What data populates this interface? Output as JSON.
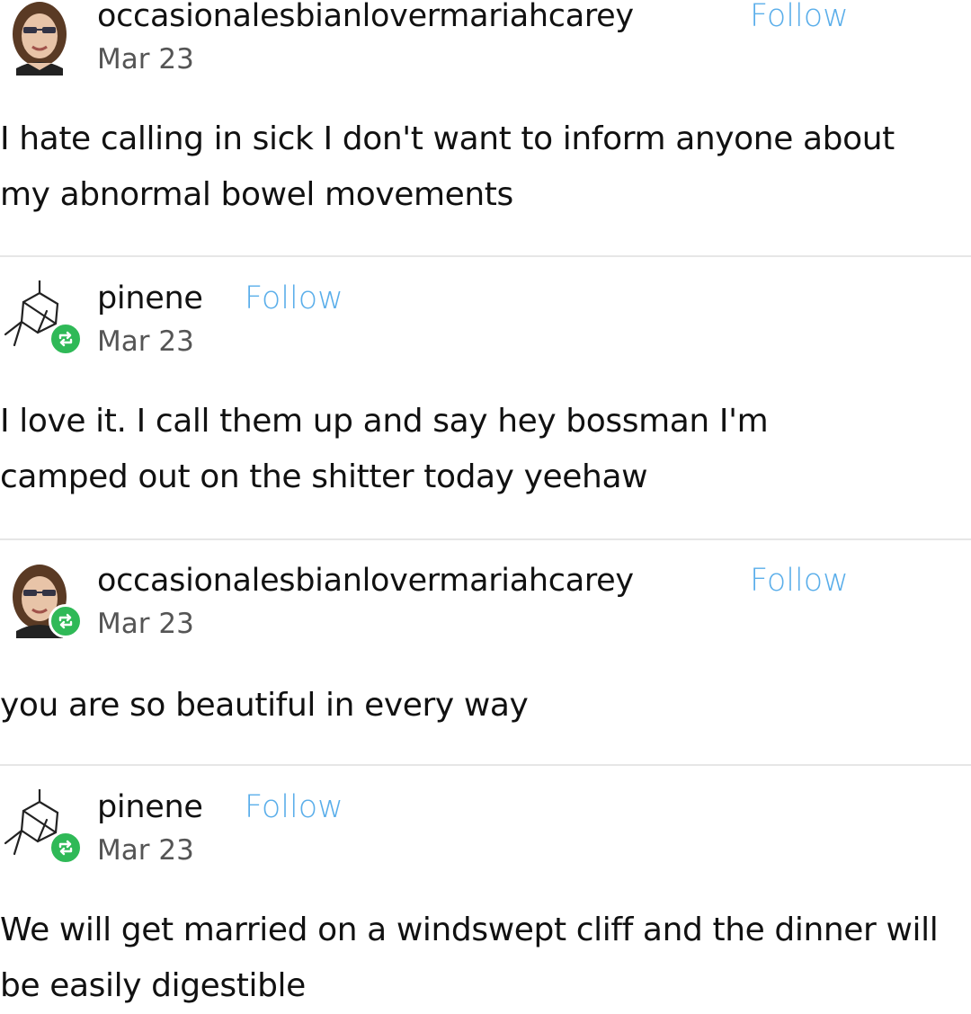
{
  "posts": [
    {
      "username": "occasionalesbianlovermariahcarey",
      "follow_label": "Follow",
      "date": "Mar 23",
      "avatar": "woman-portrait-avatar",
      "reblog_badge": false,
      "text": "I hate calling in sick I don't want to inform anyone about my abnormal bowel movements"
    },
    {
      "username": "pinene",
      "follow_label": "Follow",
      "date": "Mar 23",
      "avatar": "pinene-molecule-avatar",
      "reblog_badge": true,
      "text": "I love it. I call them up and say hey bossman I'm camped out on the shitter today yeehaw"
    },
    {
      "username": "occasionalesbianlovermariahcarey",
      "follow_label": "Follow",
      "date": "Mar 23",
      "avatar": "woman-portrait-avatar",
      "reblog_badge": true,
      "text": "you are so beautiful in every way"
    },
    {
      "username": "pinene",
      "follow_label": "Follow",
      "date": "Mar 23",
      "avatar": "pinene-molecule-avatar",
      "reblog_badge": true,
      "text": "We will get married on a windswept cliff and the dinner will be easily digestible"
    }
  ],
  "colors": {
    "follow": "#5aaeea",
    "reblog_badge": "#2fb957",
    "divider": "#e6e6e6",
    "text": "#111111",
    "date": "#555555"
  }
}
